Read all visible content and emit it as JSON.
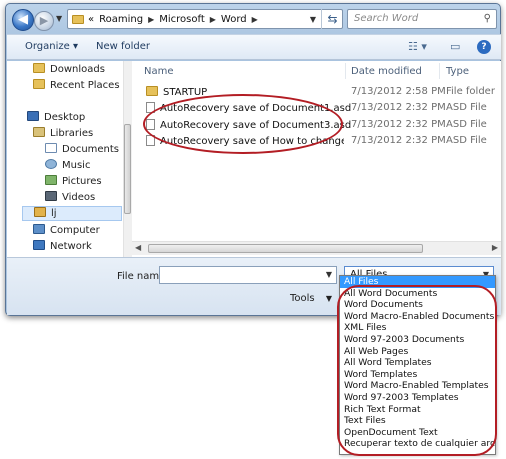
{
  "navigation": {
    "back_symbol": "◀",
    "forward_symbol": "▶",
    "breadcrumb": [
      "Roaming",
      "Microsoft",
      "Word"
    ],
    "breadcrumb_prefix": "«",
    "refresh_symbol": "⇆",
    "search_placeholder": "Search Word"
  },
  "toolbar": {
    "organize_label": "Organize ▾",
    "new_folder_label": "New folder"
  },
  "nav_pane": {
    "items": [
      {
        "label": "Downloads",
        "icon": "folder-icon"
      },
      {
        "label": "Recent Places",
        "icon": "recent-places-icon"
      },
      {
        "label": "Desktop",
        "icon": "desktop-icon"
      },
      {
        "label": "Libraries",
        "icon": "libraries-icon"
      },
      {
        "label": "Documents",
        "icon": "documents-icon"
      },
      {
        "label": "Music",
        "icon": "music-icon"
      },
      {
        "label": "Pictures",
        "icon": "pictures-icon"
      },
      {
        "label": "Videos",
        "icon": "videos-icon"
      },
      {
        "label": "lj",
        "icon": "user-folder-icon"
      },
      {
        "label": "Computer",
        "icon": "computer-icon"
      },
      {
        "label": "Network",
        "icon": "network-icon"
      }
    ]
  },
  "file_list": {
    "columns": [
      "Name",
      "Date modified",
      "Type"
    ],
    "rows": [
      {
        "name": "STARTUP",
        "date": "7/13/2012 2:58 PM",
        "type": "File folder"
      },
      {
        "name": "AutoRecovery save of Document1.asd",
        "date": "7/13/2012 2:32 PM",
        "type": "ASD File"
      },
      {
        "name": "AutoRecovery save of Document3.asd",
        "date": "7/13/2012 2:32 PM",
        "type": "ASD File"
      },
      {
        "name": "AutoRecovery save of How to change an...",
        "date": "7/13/2012 2:32 PM",
        "type": "ASD File"
      }
    ]
  },
  "bottom": {
    "file_name_label": "File name:",
    "file_name_value": "",
    "file_type_value": "All Files",
    "tools_label": "Tools"
  },
  "file_type_options": [
    "All Files",
    "All Word Documents",
    "Word Documents",
    "Word Macro-Enabled Documents",
    "XML Files",
    "Word 97-2003 Documents",
    "All Web Pages",
    "All Word Templates",
    "Word Templates",
    "Word Macro-Enabled Templates",
    "Word 97-2003 Templates",
    "Rich Text Format",
    "Text Files",
    "OpenDocument Text",
    "Recuperar texto de cualquier archivo"
  ],
  "colors": {
    "annotation": "#b31d24",
    "selection": "#3399ff"
  }
}
